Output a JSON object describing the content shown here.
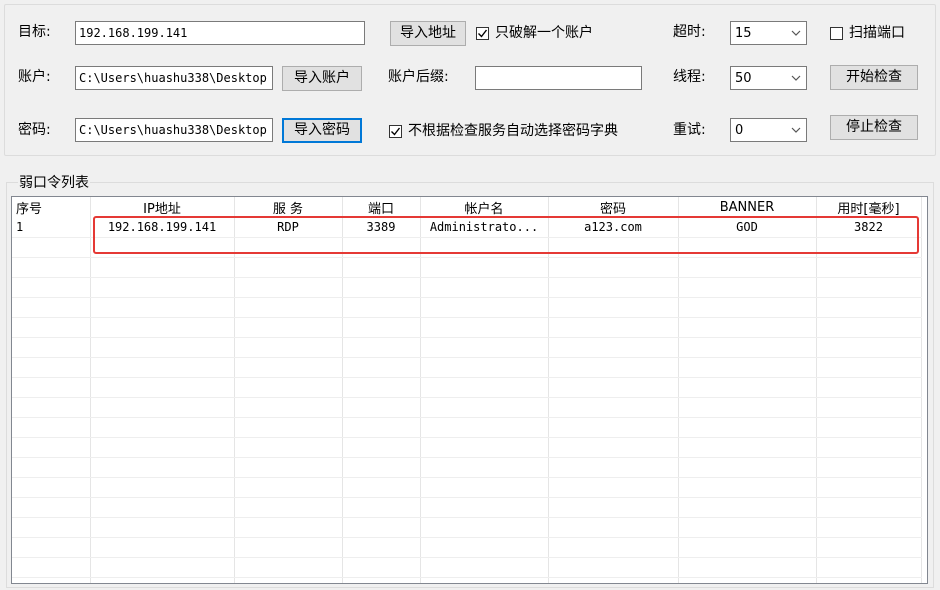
{
  "config": {
    "target_label": "目标:",
    "target_value": "192.168.199.141",
    "import_address_btn": "导入地址",
    "only_crack_one": {
      "label": "只破解一个账户",
      "checked": true
    },
    "timeout_label": "超时:",
    "timeout_value": "15",
    "scan_ports": {
      "label": "扫描端口",
      "checked": false
    },
    "account_label": "账户:",
    "account_value": "C:\\Users\\huashu338\\Desktop",
    "import_account_btn": "导入账户",
    "account_suffix_label": "账户后缀:",
    "account_suffix_value": "",
    "threads_label": "线程:",
    "threads_value": "50",
    "start_btn": "开始检查",
    "password_label": "密码:",
    "password_value": "C:\\Users\\huashu338\\Desktop",
    "import_password_btn": "导入密码",
    "auto_dict": {
      "label": "不根据检查服务自动选择密码字典",
      "checked": true
    },
    "retry_label": "重试:",
    "retry_value": "0",
    "stop_btn": "停止检查"
  },
  "list": {
    "title": "弱口令列表",
    "columns": [
      "序号",
      "IP地址",
      "服 务",
      "端口",
      "帐户名",
      "密码",
      "BANNER",
      "用时[毫秒]"
    ],
    "rows": [
      [
        "1",
        "192.168.199.141",
        "RDP",
        "3389",
        "Administrato...",
        "a123.com",
        "GOD",
        "3822"
      ]
    ]
  },
  "colors": {
    "highlight": "#e53935",
    "focus": "#0078d7"
  }
}
